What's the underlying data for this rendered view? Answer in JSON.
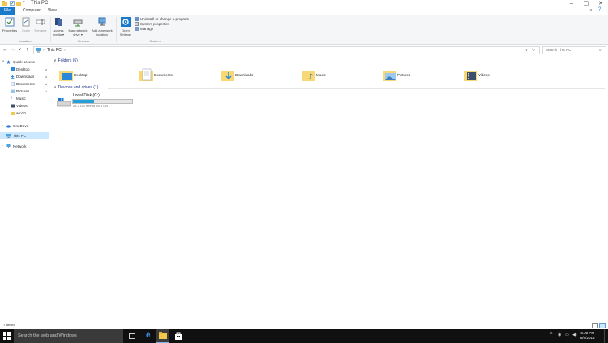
{
  "window": {
    "title": "This PC"
  },
  "ribbon": {
    "tabs": [
      "File",
      "Computer",
      "View"
    ],
    "location": {
      "properties": "Properties",
      "open": "Open",
      "rename": "Rename",
      "group_label": "Location"
    },
    "network": {
      "access_media": "Access media ▾",
      "map_network_drive": "Map network drive ▾",
      "add_network_location": "Add a network location",
      "group_label": "Network"
    },
    "system": {
      "open_settings": "Open Settings",
      "uninstall": "Uninstall or change a program",
      "system_properties": "System properties",
      "manage": "Manage",
      "group_label": "System"
    }
  },
  "address": {
    "path": "This PC",
    "search_placeholder": "Search This PC"
  },
  "navpane": {
    "quick_access": "Quick access",
    "quick_items": [
      "Desktop",
      "Downloads",
      "Documents",
      "Pictures",
      "Music",
      "Videos",
      "win10"
    ],
    "onedrive": "OneDrive",
    "this_pc": "This PC",
    "network": "Network"
  },
  "content": {
    "folders_header": "Folders (6)",
    "folders": [
      "Desktop",
      "Documents",
      "Downloads",
      "Music",
      "Pictures",
      "Videos"
    ],
    "drives_header": "Devices and drives (1)",
    "drive": {
      "name": "Local Disk (C:)",
      "free_text": "25.7 GB free of 39.5 GB",
      "used_fraction": 0.35
    }
  },
  "status": {
    "items": "7 items"
  },
  "taskbar": {
    "search_placeholder": "Search the web and Windows",
    "time": "5:05 PM",
    "date": "8/2/2015"
  },
  "colors": {
    "accent": "#1979ca",
    "selection": "#cce8ff",
    "folder_yellow": "#f8d775",
    "taskbar": "#101010"
  }
}
